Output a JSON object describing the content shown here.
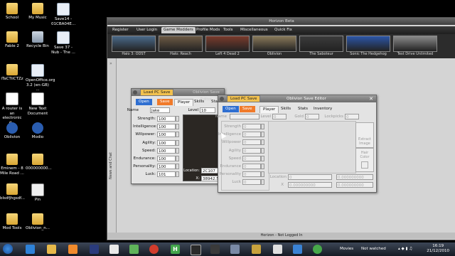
{
  "desktop": {
    "icons": [
      {
        "label": "School",
        "kind": "folder"
      },
      {
        "label": "My Music",
        "kind": "folder"
      },
      {
        "label": "Save14 - 01CBA04E...",
        "kind": "doc"
      },
      {
        "label": "Fable 2",
        "kind": "folder"
      },
      {
        "label": "Recycle Bin",
        "kind": "bin"
      },
      {
        "label": "Save 37 - Nub - The ...",
        "kind": "doc"
      },
      {
        "label": "iTaCTiiCTZz",
        "kind": "folder"
      },
      {
        "label": "OpenOffice.org 3.2 (en-GB) ...",
        "kind": "doc"
      },
      {
        "label": "A router is an electronic d...",
        "kind": "text"
      },
      {
        "label": "New Text Document",
        "kind": "text"
      },
      {
        "label": "Oblivion",
        "kind": "circle"
      },
      {
        "label": "Modio",
        "kind": "circle"
      },
      {
        "label": "Eminem - 8 Mile Road ...",
        "kind": "folder"
      },
      {
        "label": "000000000...",
        "kind": "folder"
      },
      {
        "label": "blsdfjhgsdf...",
        "kind": "folder"
      },
      {
        "label": "Pin",
        "kind": "pin"
      },
      {
        "label": "Mod Tools",
        "kind": "folder"
      },
      {
        "label": "Oblivion_n...",
        "kind": "folder"
      }
    ]
  },
  "horizon": {
    "title": "Horizon Beta",
    "menu": [
      "Register",
      "User Login",
      "Game Modders",
      "Profile Mods",
      "Tools",
      "Miscellaneous",
      "Quick Fix"
    ],
    "active_menu": "Game Modders",
    "games": [
      "Halo 3: ODST",
      "Halo: Reach",
      "Left 4 Dead 2",
      "Oblivion",
      "The Saboteur",
      "Sonic The Hedgehog",
      "Test Drive Unlimited"
    ],
    "side_label": "News and Chat",
    "status": "Horizon - Not Logged In"
  },
  "editor_back": {
    "title": "Oblivion Save Editor",
    "load_label": "Load PC Save",
    "open": "Open",
    "save": "Save",
    "tabs": [
      "Player",
      "Skills",
      "Stats"
    ],
    "name_label": "Name",
    "name_value": "Jake",
    "level_label": "Level",
    "level_value": "10",
    "stats": [
      {
        "label": "Strength:",
        "value": "100"
      },
      {
        "label": "Intelligence:",
        "value": "100"
      },
      {
        "label": "Willpower:",
        "value": "100"
      },
      {
        "label": "Agility:",
        "value": "100"
      },
      {
        "label": "Speed:",
        "value": "100"
      },
      {
        "label": "Endurance:",
        "value": "100"
      },
      {
        "label": "Personality:",
        "value": "100"
      },
      {
        "label": "Luck:",
        "value": "101"
      }
    ],
    "location_label": "Location:",
    "location_value": "2C107",
    "x_label": "X:",
    "x_value": "38942.54"
  },
  "editor_front": {
    "title": "Oblivion Save Editor",
    "load_label": "Load PC Save",
    "open": "Open",
    "save": "Save",
    "tabs": [
      "Player",
      "Skills",
      "Stats",
      "Inventory"
    ],
    "name_label": "Name",
    "level_label": "Level",
    "level_value": "0",
    "gold_label": "Gold",
    "gold_value": "0",
    "lockpick_label": "Lockpicks",
    "lockpick_value": "0",
    "stats": [
      {
        "label": "Strength",
        "value": "0"
      },
      {
        "label": "Intelligence",
        "value": "0"
      },
      {
        "label": "Willpower",
        "value": "0"
      },
      {
        "label": "Agility",
        "value": "0"
      },
      {
        "label": "Speed",
        "value": "0"
      },
      {
        "label": "Endurance",
        "value": "0"
      },
      {
        "label": "Personality",
        "value": "0"
      },
      {
        "label": "Luck",
        "value": "0"
      }
    ],
    "extract_label": "Extract Image",
    "hair_label": "Hair Color",
    "location_label": "Location",
    "location_value": "0",
    "coord_a": "0.000000000",
    "x_label": "X",
    "coord_x": "0.000000000",
    "coord_b": "0.000000000"
  },
  "taskbar": {
    "movies_label": "Movies",
    "network_label": "Not watched",
    "time": "16:19",
    "date": "21/12/2010"
  }
}
